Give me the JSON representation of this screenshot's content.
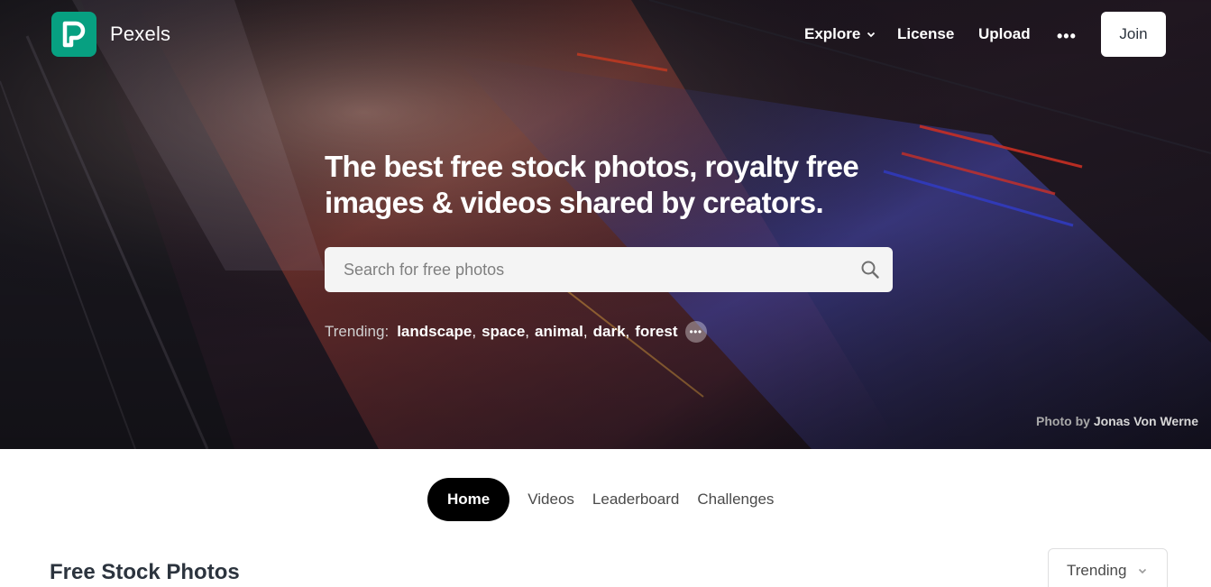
{
  "app": {
    "brand": "Pexels"
  },
  "nav": {
    "explore_label": "Explore",
    "license_label": "License",
    "upload_label": "Upload",
    "more_label": "•••",
    "join_label": "Join"
  },
  "hero": {
    "headline": "The best free stock photos, royalty free images & videos shared by creators.",
    "search_placeholder": "Search for free photos",
    "trending_label": "Trending:",
    "trending": [
      "landscape",
      "space",
      "animal",
      "dark",
      "forest"
    ],
    "credit_prefix": "Photo by",
    "credit_author": "Jonas Von Werne"
  },
  "tabs": [
    {
      "label": "Home",
      "active": true
    },
    {
      "label": "Videos",
      "active": false
    },
    {
      "label": "Leaderboard",
      "active": false
    },
    {
      "label": "Challenges",
      "active": false
    }
  ],
  "main": {
    "title": "Free Stock Photos",
    "sort_value": "Trending"
  },
  "colors": {
    "brand": "#07a081",
    "active_tab": "#000000"
  }
}
